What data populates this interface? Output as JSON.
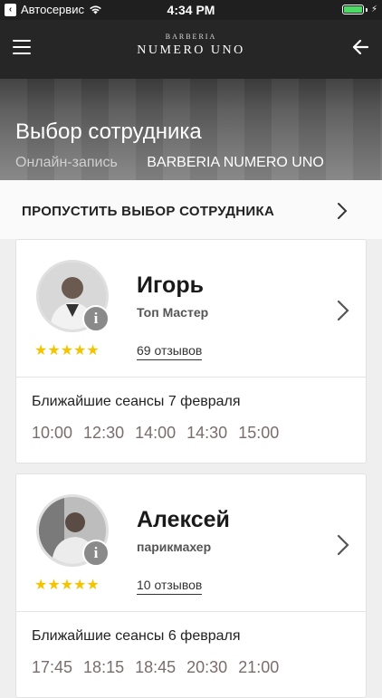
{
  "status": {
    "carrier": "Автосервис",
    "time": "4:34 PM"
  },
  "header": {
    "logo_small": "BARBERIA",
    "logo_big": "NUMERO UNO"
  },
  "hero": {
    "title": "Выбор сотрудника",
    "crumb1": "Онлайн-запись",
    "crumb2": "BARBERIA NUMERO UNO"
  },
  "skip": {
    "label": "ПРОПУСТИТЬ ВЫБОР СОТРУДНИКА"
  },
  "employees": [
    {
      "name": "Игорь",
      "role": "Топ Мастер",
      "stars": "★★★★★",
      "reviews": "69 отзывов",
      "sessions_label": "Ближайшие сеансы 7 февраля",
      "times": [
        "10:00",
        "12:30",
        "14:00",
        "14:30",
        "15:00"
      ]
    },
    {
      "name": "Алексей",
      "role": "парикмахер",
      "stars": "★★★★★",
      "reviews": "10 отзывов",
      "sessions_label": "Ближайшие сеансы 6 февраля",
      "times": [
        "17:45",
        "18:15",
        "18:45",
        "20:30",
        "21:00"
      ]
    }
  ],
  "colors": {
    "accent_star": "#f5c400",
    "header_bg": "#262626"
  }
}
